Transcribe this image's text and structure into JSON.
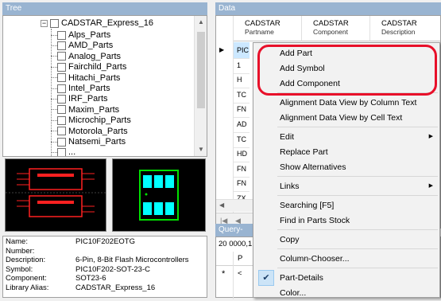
{
  "panels": {
    "tree_title": "Tree",
    "data_title": "Data",
    "query_title": "Query-Buil"
  },
  "tree": {
    "root": "CADSTAR_Express_16",
    "items": [
      "Alps_Parts",
      "AMD_Parts",
      "Analog_Parts",
      "Fairchild_Parts",
      "Hitachi_Parts",
      "Intel_Parts",
      "IRF_Parts",
      "Maxim_Parts",
      "Microchip_Parts",
      "Motorola_Parts",
      "Natsemi_Parts",
      "..."
    ]
  },
  "details": {
    "rows": [
      {
        "label": "Name:",
        "value": "PIC10F202EOTG"
      },
      {
        "label": "Number:",
        "value": ""
      },
      {
        "label": "Description:",
        "value": "6-Pin, 8-Bit Flash Microcontrollers"
      },
      {
        "label": "Symbol:",
        "value": "PIC10F202-SOT-23-C"
      },
      {
        "label": "Component:",
        "value": "SOT23-6"
      },
      {
        "label": "Library Alias:",
        "value": "CADSTAR_Express_16"
      }
    ]
  },
  "grid": {
    "columns": [
      {
        "title": "CADSTAR",
        "sub": "Partname"
      },
      {
        "title": "CADSTAR",
        "sub": "Component"
      },
      {
        "title": "CADSTAR",
        "sub": "Description"
      }
    ],
    "row_cells": [
      "PIC",
      "1",
      "H",
      "TC",
      "FN",
      "AD",
      "TC",
      "HD",
      "FN",
      "FN",
      "ZX"
    ],
    "current_row_marker": "▶"
  },
  "query": {
    "value": "20 0000,1",
    "col_header": "P",
    "new_row_marker": "*",
    "new_row_cell": "<"
  },
  "context_menu": {
    "items": [
      {
        "label": "Add Part",
        "submenu": false,
        "checked": false
      },
      {
        "label": "Add Symbol",
        "submenu": false,
        "checked": false
      },
      {
        "label": "Add Component",
        "submenu": false,
        "checked": false
      },
      {
        "label": "Alignment Data View by Column Text",
        "submenu": false,
        "checked": false
      },
      {
        "label": "Alignment Data View by Cell Text",
        "submenu": false,
        "checked": false
      },
      {
        "label": "Edit",
        "submenu": true,
        "checked": false
      },
      {
        "label": "Replace Part",
        "submenu": false,
        "checked": false
      },
      {
        "label": "Show Alternatives",
        "submenu": false,
        "checked": false
      },
      {
        "label": "Links",
        "submenu": true,
        "checked": false
      },
      {
        "label": "Searching [F5]",
        "submenu": false,
        "checked": false
      },
      {
        "label": "Find in Parts Stock",
        "submenu": false,
        "checked": false
      },
      {
        "label": "Copy",
        "submenu": false,
        "checked": false
      },
      {
        "label": "Column-Chooser...",
        "submenu": false,
        "checked": false
      },
      {
        "label": "Part-Details",
        "submenu": false,
        "checked": true
      },
      {
        "label": "Color...",
        "submenu": false,
        "checked": false
      }
    ],
    "submenu_arrow": "▶",
    "check_mark": "✔"
  },
  "colors": {
    "panel_title": "#99b4d1",
    "highlight_ring": "#e8102a",
    "footprint_red": "#ff2020",
    "footprint_green": "#00e000",
    "footprint_cyan": "#00ffff"
  }
}
